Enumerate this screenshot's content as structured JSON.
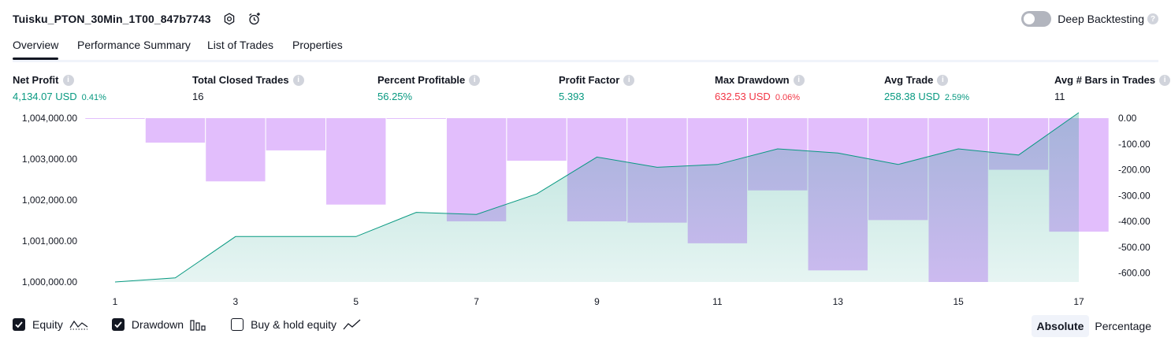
{
  "header": {
    "title": "Tuisku_PTON_30Min_1T00_847b7743",
    "settings_icon": "gear-icon",
    "alert_icon": "add-alert-clock-icon",
    "deep_backtesting_label": "Deep Backtesting",
    "deep_backtesting_enabled": false,
    "help_icon": "question-icon",
    "help_glyph": "?"
  },
  "tabs": [
    {
      "label": "Overview",
      "active": true
    },
    {
      "label": "Performance Summary",
      "active": false
    },
    {
      "label": "List of Trades",
      "active": false
    },
    {
      "label": "Properties",
      "active": false
    }
  ],
  "metrics": [
    {
      "label": "Net Profit",
      "value": "4,134.07 USD",
      "pct": "0.41%",
      "color": "#089981"
    },
    {
      "label": "Total Closed Trades",
      "value": "16",
      "pct": "",
      "color": "#131722"
    },
    {
      "label": "Percent Profitable",
      "value": "56.25%",
      "pct": "",
      "color": "#089981"
    },
    {
      "label": "Profit Factor",
      "value": "5.393",
      "pct": "",
      "color": "#089981"
    },
    {
      "label": "Max Drawdown",
      "value": "632.53 USD",
      "pct": "0.06%",
      "color": "#f23645"
    },
    {
      "label": "Avg Trade",
      "value": "258.38 USD",
      "pct": "2.59%",
      "color": "#089981"
    },
    {
      "label": "Avg # Bars in Trades",
      "value": "11",
      "pct": "",
      "color": "#131722"
    }
  ],
  "chart_data": {
    "type": "bar+area",
    "x": [
      1,
      2,
      3,
      4,
      5,
      6,
      7,
      8,
      9,
      10,
      11,
      12,
      13,
      14,
      15,
      16,
      17
    ],
    "x_tick_labels": [
      "1",
      "3",
      "5",
      "7",
      "9",
      "11",
      "13",
      "15",
      "17"
    ],
    "series": [
      {
        "name": "Equity",
        "kind": "area",
        "axis": "left",
        "color": "#089981",
        "values": [
          1000000,
          1000100,
          1001110,
          1001110,
          1001110,
          1001700,
          1001650,
          1002150,
          1003050,
          1002800,
          1002870,
          1003250,
          1003150,
          1002870,
          1003250,
          1003100,
          1004134.07
        ]
      },
      {
        "name": "Drawdown",
        "kind": "bar",
        "axis": "right",
        "color": "#ce93fa",
        "values": [
          0,
          -95,
          -245,
          -125,
          -335,
          0,
          -400,
          -165,
          -400,
          -405,
          -485,
          -280,
          -590,
          -395,
          -635,
          -200,
          -440
        ]
      }
    ],
    "left_axis": {
      "ticks": [
        "1,004,000.00",
        "1,003,000.00",
        "1,002,000.00",
        "1,001,000.00",
        "1,000,000.00"
      ],
      "range": [
        1000000,
        1004000
      ]
    },
    "right_axis": {
      "ticks": [
        "0.00",
        "-100.00",
        "-200.00",
        "-300.00",
        "-400.00",
        "-500.00",
        "-600.00"
      ],
      "range": [
        -635,
        0
      ]
    }
  },
  "legend": [
    {
      "label": "Equity",
      "checked": true,
      "icon": "equity-line-icon"
    },
    {
      "label": "Drawdown",
      "checked": true,
      "icon": "drawdown-bars-icon"
    },
    {
      "label": "Buy & hold equity",
      "checked": false,
      "icon": "buy-hold-line-icon"
    }
  ],
  "mode": {
    "absolute_label": "Absolute",
    "percentage_label": "Percentage",
    "selected": "Absolute"
  }
}
